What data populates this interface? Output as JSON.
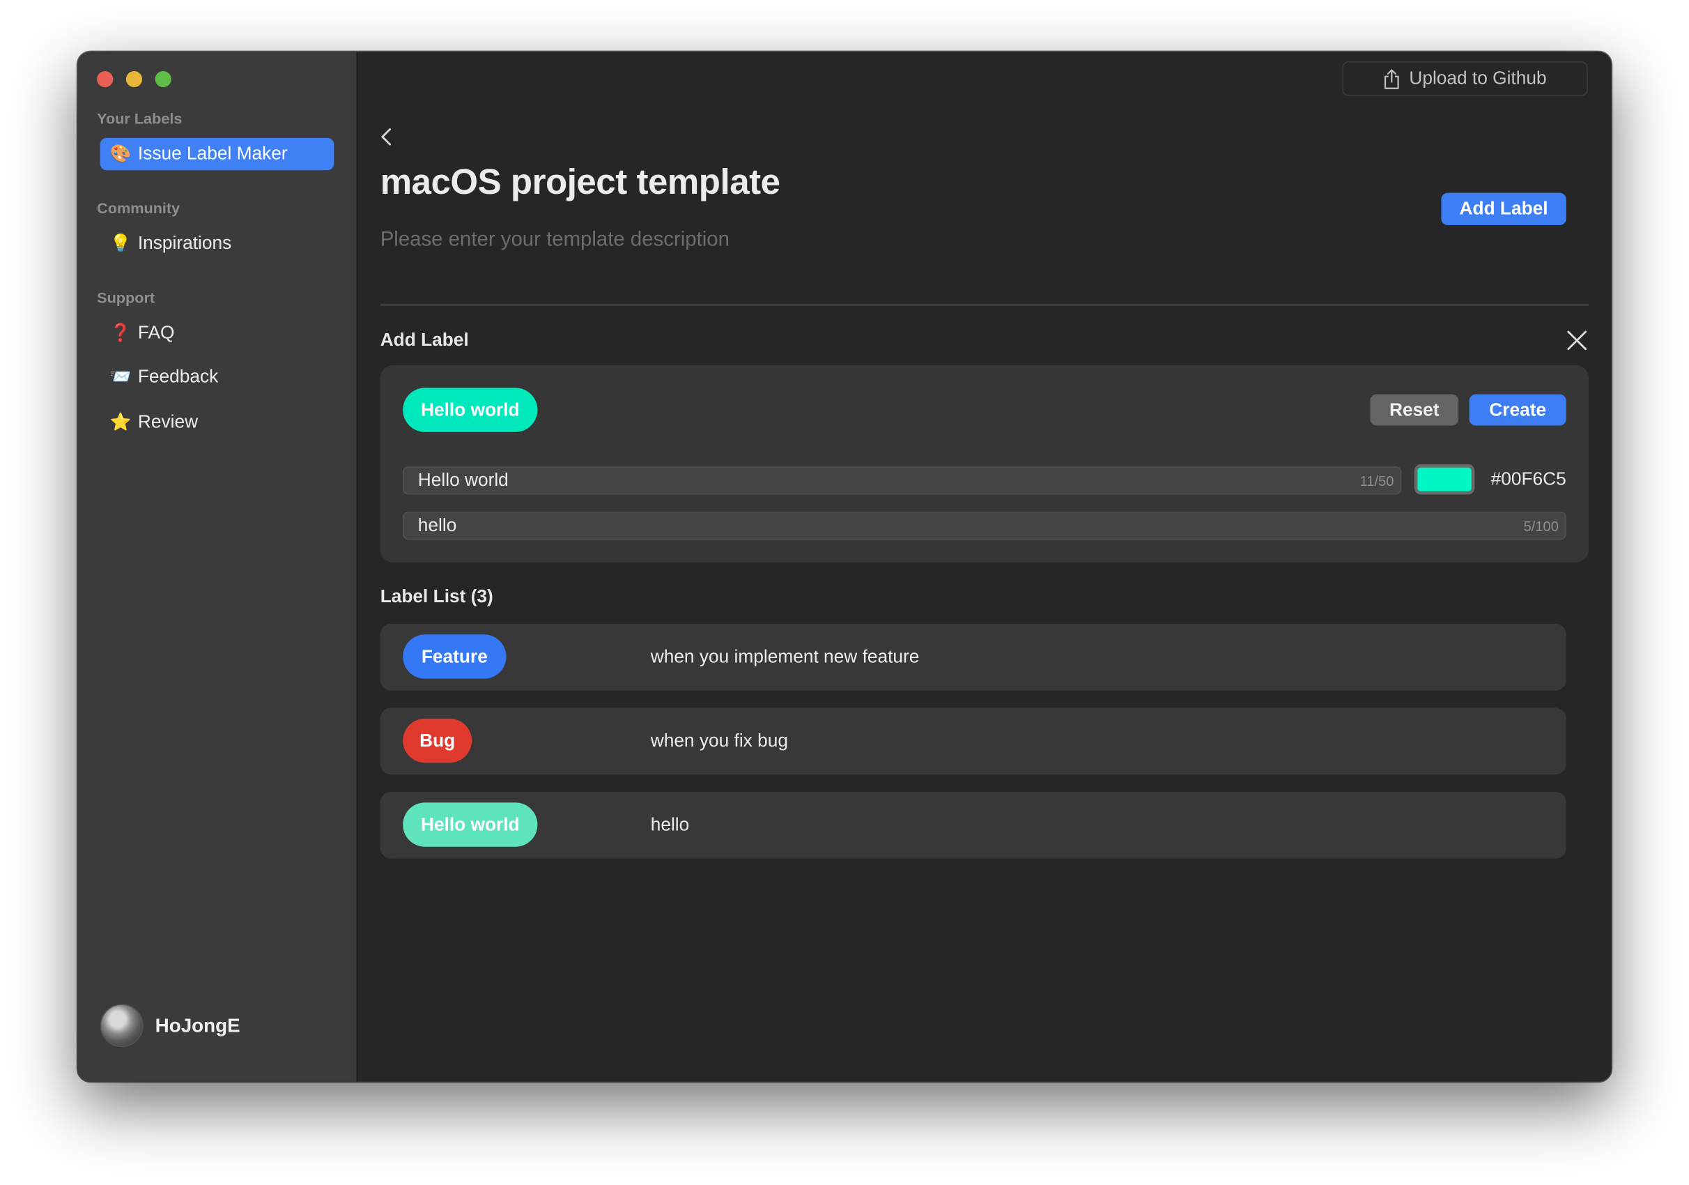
{
  "sidebar": {
    "sections": [
      {
        "title": "Your Labels",
        "items": [
          {
            "emoji": "🎨",
            "label": "Issue Label Maker",
            "active": true
          }
        ]
      },
      {
        "title": "Community",
        "items": [
          {
            "emoji": "💡",
            "label": "Inspirations"
          }
        ]
      },
      {
        "title": "Support",
        "items": [
          {
            "emoji": "❓",
            "label": "FAQ"
          },
          {
            "emoji": "📨",
            "label": "Feedback"
          },
          {
            "emoji": "⭐",
            "label": "Review"
          }
        ]
      }
    ],
    "user": {
      "name": "HoJongE"
    }
  },
  "toolbar": {
    "upload_label": "Upload to Github"
  },
  "template": {
    "title": "macOS project template",
    "description_placeholder": "Please enter your template description",
    "add_label_button": "Add Label"
  },
  "add_label_form": {
    "heading": "Add Label",
    "preview_label": "Hello world",
    "reset_label": "Reset",
    "create_label": "Create",
    "name_value": "Hello world",
    "name_count": "11/50",
    "description_value": "hello",
    "description_count": "5/100",
    "color_hex": "#00F6C5",
    "color": "#00F6C5"
  },
  "label_list": {
    "heading": "Label List (3)",
    "items": [
      {
        "name": "Feature",
        "description": "when you implement new feature",
        "color": "#3478F6"
      },
      {
        "name": "Bug",
        "description": "when you fix bug",
        "color": "#E0392D"
      },
      {
        "name": "Hello world",
        "description": "hello",
        "color": "#5FE3BC"
      }
    ]
  },
  "colors": {
    "accent": "#3D7EF5",
    "sidebar_bg": "#3B3B3B",
    "main_bg": "#262626"
  }
}
